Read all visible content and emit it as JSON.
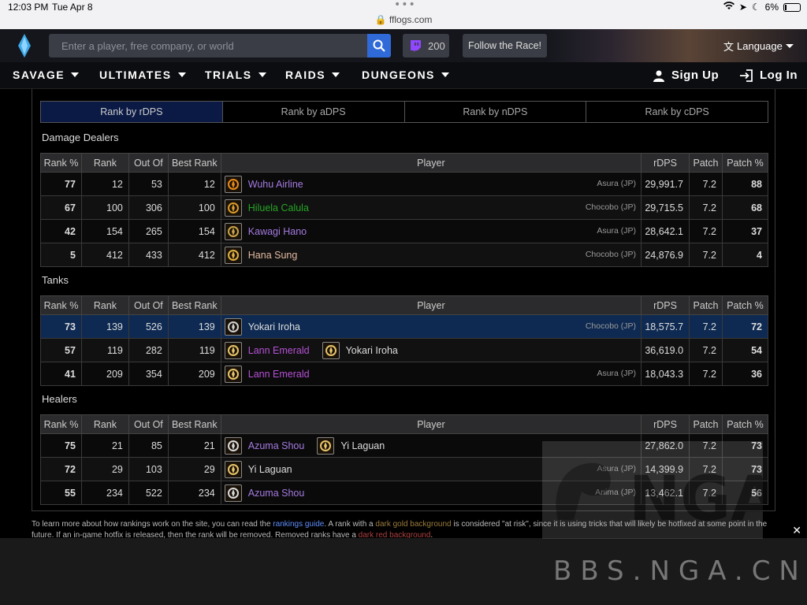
{
  "status_bar": {
    "time": "12:03 PM",
    "date": "Tue Apr 8",
    "url": "fflogs.com",
    "battery": "6%"
  },
  "header": {
    "search_placeholder": "Enter a player, free company, or world",
    "twitch_count": "200",
    "follow_label": "Follow the Race!",
    "language_label": "Language"
  },
  "nav": {
    "items": [
      "SAVAGE",
      "ULTIMATES",
      "TRIALS",
      "RAIDS",
      "DUNGEONS"
    ],
    "sign_up": "Sign Up",
    "log_in": "Log In"
  },
  "tabs": [
    "Rank by rDPS",
    "Rank by aDPS",
    "Rank by nDPS",
    "Rank by cDPS"
  ],
  "columns": [
    "Rank %",
    "Rank",
    "Out Of",
    "Best Rank",
    "Player",
    "rDPS",
    "Patch",
    "Patch %"
  ],
  "sections": {
    "dps": {
      "title": "Damage Dealers",
      "rows": [
        {
          "rank_pct": "77",
          "rank": "12",
          "out_of": "53",
          "best": "12",
          "player": "Wuhu Airline",
          "server": "Asura (JP)",
          "rdps": "29,991.7",
          "patch": "7.2",
          "patch_pct": "88"
        },
        {
          "rank_pct": "67",
          "rank": "100",
          "out_of": "306",
          "best": "100",
          "player": "Hiluela Calula",
          "server": "Chocobo (JP)",
          "rdps": "29,715.5",
          "patch": "7.2",
          "patch_pct": "68"
        },
        {
          "rank_pct": "42",
          "rank": "154",
          "out_of": "265",
          "best": "154",
          "player": "Kawagi Hano",
          "server": "Asura (JP)",
          "rdps": "28,642.1",
          "patch": "7.2",
          "patch_pct": "37"
        },
        {
          "rank_pct": "5",
          "rank": "412",
          "out_of": "433",
          "best": "412",
          "player": "Hana Sung",
          "server": "Chocobo (JP)",
          "rdps": "24,876.9",
          "patch": "7.2",
          "patch_pct": "4"
        }
      ]
    },
    "tanks": {
      "title": "Tanks",
      "rows": [
        {
          "rank_pct": "73",
          "rank": "139",
          "out_of": "526",
          "best": "139",
          "player": "Yokari Iroha",
          "server": "Chocobo (JP)",
          "rdps": "18,575.7",
          "patch": "7.2",
          "patch_pct": "72"
        },
        {
          "rank_pct": "57",
          "rank": "119",
          "out_of": "282",
          "best": "119",
          "player": "Lann Emerald",
          "player2": "Yokari Iroha",
          "rdps": "36,619.0",
          "patch": "7.2",
          "patch_pct": "54"
        },
        {
          "rank_pct": "41",
          "rank": "209",
          "out_of": "354",
          "best": "209",
          "player": "Lann Emerald",
          "server": "Asura (JP)",
          "rdps": "18,043.3",
          "patch": "7.2",
          "patch_pct": "36"
        }
      ]
    },
    "healers": {
      "title": "Healers",
      "rows": [
        {
          "rank_pct": "75",
          "rank": "21",
          "out_of": "85",
          "best": "21",
          "player": "Azuma Shou",
          "player2": "Yi Laguan",
          "rdps": "27,862.0",
          "patch": "7.2",
          "patch_pct": "73"
        },
        {
          "rank_pct": "72",
          "rank": "29",
          "out_of": "103",
          "best": "29",
          "player": "Yi Laguan",
          "server": "Asura (JP)",
          "rdps": "14,399.9",
          "patch": "7.2",
          "patch_pct": "73"
        },
        {
          "rank_pct": "55",
          "rank": "234",
          "out_of": "522",
          "best": "234",
          "player": "Azuma Shou",
          "server": "Anima (JP)",
          "rdps": "13,462.1",
          "patch": "7.2",
          "patch_pct": "56"
        }
      ]
    }
  },
  "footer": {
    "t1": "To learn more about how rankings work on the site, you can read the ",
    "link1": "rankings guide",
    "t2": ". A rank with a ",
    "link2": "dark gold background",
    "t3": " is considered \"at risk\", since it is using tricks that will likely be hotfixed at some point in the future. If an in-game hotfix is released, then the rank will be removed. Removed ranks have a ",
    "link3": "dark red background",
    "t4": "."
  },
  "watermark": {
    "text": "BBS.NGA.CN",
    "logo_text": "NGA"
  },
  "colors": {
    "accent_blue": "#2f6ad8",
    "rank_purple": "#a65de8",
    "rank_blue": "#3b8cf0",
    "rank_green": "#35d035",
    "rank_grey": "#777777"
  }
}
